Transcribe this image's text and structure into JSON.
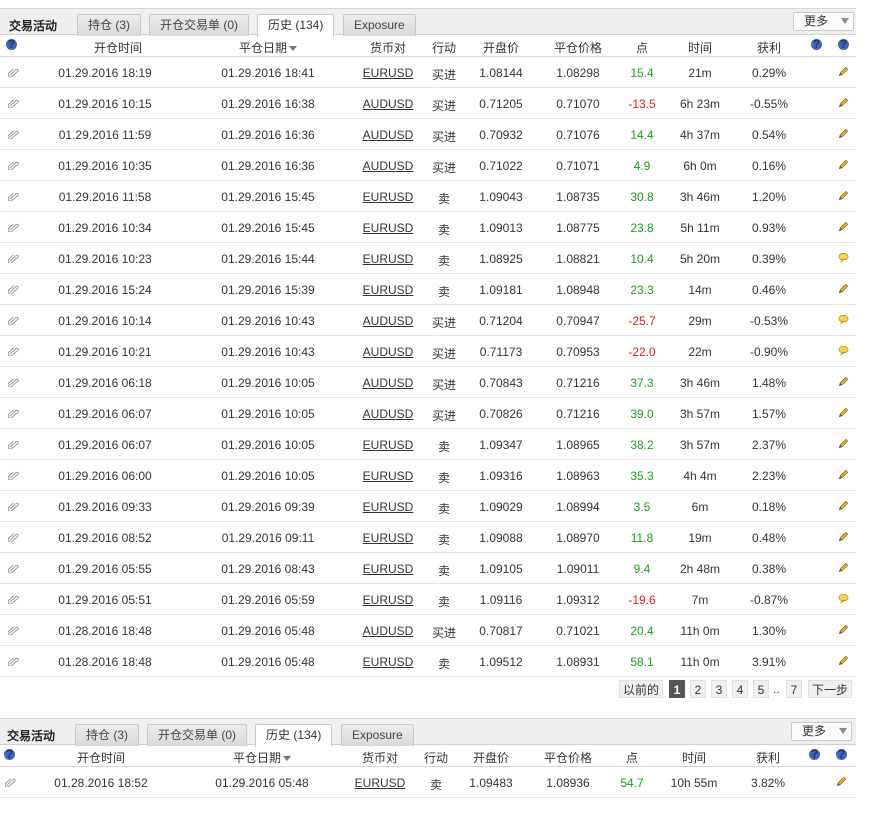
{
  "panel1": {
    "title": "交易活动",
    "tabs": [
      "持仓 (3)",
      "开仓交易单 (0)",
      "历史 (134)",
      "Exposure"
    ],
    "more_label": "更多",
    "headers": {
      "open_time": "开仓时间",
      "close_date": "平仓日期",
      "symbol": "货币对",
      "action": "行动",
      "open_price": "开盘价",
      "close_price": "平仓价格",
      "points": "点",
      "duration": "时间",
      "profit": "获利"
    },
    "rows": [
      {
        "open": "01.29.2016 18:19",
        "close": "01.29.2016 18:41",
        "sym": "EURUSD",
        "act": "买进",
        "op": "1.08144",
        "cp": "1.08298",
        "pts": "15.4",
        "dur": "21m",
        "pl": "0.29%",
        "icon": "pencil"
      },
      {
        "open": "01.29.2016 10:15",
        "close": "01.29.2016 16:38",
        "sym": "AUDUSD",
        "act": "买进",
        "op": "0.71205",
        "cp": "0.71070",
        "pts": "-13.5",
        "dur": "6h 23m",
        "pl": "-0.55%",
        "icon": "pencil"
      },
      {
        "open": "01.29.2016 11:59",
        "close": "01.29.2016 16:36",
        "sym": "AUDUSD",
        "act": "买进",
        "op": "0.70932",
        "cp": "0.71076",
        "pts": "14.4",
        "dur": "4h 37m",
        "pl": "0.54%",
        "icon": "pencil"
      },
      {
        "open": "01.29.2016 10:35",
        "close": "01.29.2016 16:36",
        "sym": "AUDUSD",
        "act": "买进",
        "op": "0.71022",
        "cp": "0.71071",
        "pts": "4.9",
        "dur": "6h 0m",
        "pl": "0.16%",
        "icon": "pencil"
      },
      {
        "open": "01.29.2016 11:58",
        "close": "01.29.2016 15:45",
        "sym": "EURUSD",
        "act": "卖",
        "op": "1.09043",
        "cp": "1.08735",
        "pts": "30.8",
        "dur": "3h 46m",
        "pl": "1.20%",
        "icon": "pencil"
      },
      {
        "open": "01.29.2016 10:34",
        "close": "01.29.2016 15:45",
        "sym": "EURUSD",
        "act": "卖",
        "op": "1.09013",
        "cp": "1.08775",
        "pts": "23.8",
        "dur": "5h 11m",
        "pl": "0.93%",
        "icon": "pencil"
      },
      {
        "open": "01.29.2016 10:23",
        "close": "01.29.2016 15:44",
        "sym": "EURUSD",
        "act": "卖",
        "op": "1.08925",
        "cp": "1.08821",
        "pts": "10.4",
        "dur": "5h 20m",
        "pl": "0.39%",
        "icon": "comment"
      },
      {
        "open": "01.29.2016 15:24",
        "close": "01.29.2016 15:39",
        "sym": "EURUSD",
        "act": "卖",
        "op": "1.09181",
        "cp": "1.08948",
        "pts": "23.3",
        "dur": "14m",
        "pl": "0.46%",
        "icon": "pencil"
      },
      {
        "open": "01.29.2016 10:14",
        "close": "01.29.2016 10:43",
        "sym": "AUDUSD",
        "act": "买进",
        "op": "0.71204",
        "cp": "0.70947",
        "pts": "-25.7",
        "dur": "29m",
        "pl": "-0.53%",
        "icon": "comment"
      },
      {
        "open": "01.29.2016 10:21",
        "close": "01.29.2016 10:43",
        "sym": "AUDUSD",
        "act": "买进",
        "op": "0.71173",
        "cp": "0.70953",
        "pts": "-22.0",
        "dur": "22m",
        "pl": "-0.90%",
        "icon": "comment"
      },
      {
        "open": "01.29.2016 06:18",
        "close": "01.29.2016 10:05",
        "sym": "AUDUSD",
        "act": "买进",
        "op": "0.70843",
        "cp": "0.71216",
        "pts": "37.3",
        "dur": "3h 46m",
        "pl": "1.48%",
        "icon": "pencil"
      },
      {
        "open": "01.29.2016 06:07",
        "close": "01.29.2016 10:05",
        "sym": "AUDUSD",
        "act": "买进",
        "op": "0.70826",
        "cp": "0.71216",
        "pts": "39.0",
        "dur": "3h 57m",
        "pl": "1.57%",
        "icon": "pencil"
      },
      {
        "open": "01.29.2016 06:07",
        "close": "01.29.2016 10:05",
        "sym": "EURUSD",
        "act": "卖",
        "op": "1.09347",
        "cp": "1.08965",
        "pts": "38.2",
        "dur": "3h 57m",
        "pl": "2.37%",
        "icon": "pencil"
      },
      {
        "open": "01.29.2016 06:00",
        "close": "01.29.2016 10:05",
        "sym": "EURUSD",
        "act": "卖",
        "op": "1.09316",
        "cp": "1.08963",
        "pts": "35.3",
        "dur": "4h 4m",
        "pl": "2.23%",
        "icon": "pencil"
      },
      {
        "open": "01.29.2016 09:33",
        "close": "01.29.2016 09:39",
        "sym": "EURUSD",
        "act": "卖",
        "op": "1.09029",
        "cp": "1.08994",
        "pts": "3.5",
        "dur": "6m",
        "pl": "0.18%",
        "icon": "pencil"
      },
      {
        "open": "01.29.2016 08:52",
        "close": "01.29.2016 09:11",
        "sym": "EURUSD",
        "act": "卖",
        "op": "1.09088",
        "cp": "1.08970",
        "pts": "11.8",
        "dur": "19m",
        "pl": "0.48%",
        "icon": "pencil"
      },
      {
        "open": "01.29.2016 05:55",
        "close": "01.29.2016 08:43",
        "sym": "EURUSD",
        "act": "卖",
        "op": "1.09105",
        "cp": "1.09011",
        "pts": "9.4",
        "dur": "2h 48m",
        "pl": "0.38%",
        "icon": "pencil"
      },
      {
        "open": "01.29.2016 05:51",
        "close": "01.29.2016 05:59",
        "sym": "EURUSD",
        "act": "卖",
        "op": "1.09116",
        "cp": "1.09312",
        "pts": "-19.6",
        "dur": "7m",
        "pl": "-0.87%",
        "icon": "comment"
      },
      {
        "open": "01.28.2016 18:48",
        "close": "01.29.2016 05:48",
        "sym": "AUDUSD",
        "act": "买进",
        "op": "0.70817",
        "cp": "0.71021",
        "pts": "20.4",
        "dur": "11h 0m",
        "pl": "1.30%",
        "icon": "pencil"
      },
      {
        "open": "01.28.2016 18:48",
        "close": "01.29.2016 05:48",
        "sym": "EURUSD",
        "act": "卖",
        "op": "1.09512",
        "cp": "1.08931",
        "pts": "58.1",
        "dur": "11h 0m",
        "pl": "3.91%",
        "icon": "pencil"
      }
    ]
  },
  "pager": {
    "prev_label": "以前的",
    "pages": [
      "1",
      "2",
      "3",
      "4",
      "5"
    ],
    "ellipsis": "..",
    "last_page": "7",
    "next_label": "下一步",
    "current": "1"
  },
  "panel2": {
    "title": "交易活动",
    "tabs": [
      "持仓 (3)",
      "开仓交易单 (0)",
      "历史 (134)",
      "Exposure"
    ],
    "more_label": "更多",
    "headers": {
      "open_time": "开仓时间",
      "close_date": "平仓日期",
      "symbol": "货币对",
      "action": "行动",
      "open_price": "开盘价",
      "close_price": "平仓价格",
      "points": "点",
      "duration": "时间",
      "profit": "获利"
    },
    "rows": [
      {
        "open": "01.28.2016 18:52",
        "close": "01.29.2016 05:48",
        "sym": "EURUSD",
        "act": "卖",
        "op": "1.09483",
        "cp": "1.08936",
        "pts": "54.7",
        "dur": "10h 55m",
        "pl": "3.82%",
        "icon": "pencil"
      }
    ]
  },
  "colors": {
    "positive": "#1b9d1b",
    "negative": "#e01b1b",
    "help_icon": "#3a67c6"
  }
}
